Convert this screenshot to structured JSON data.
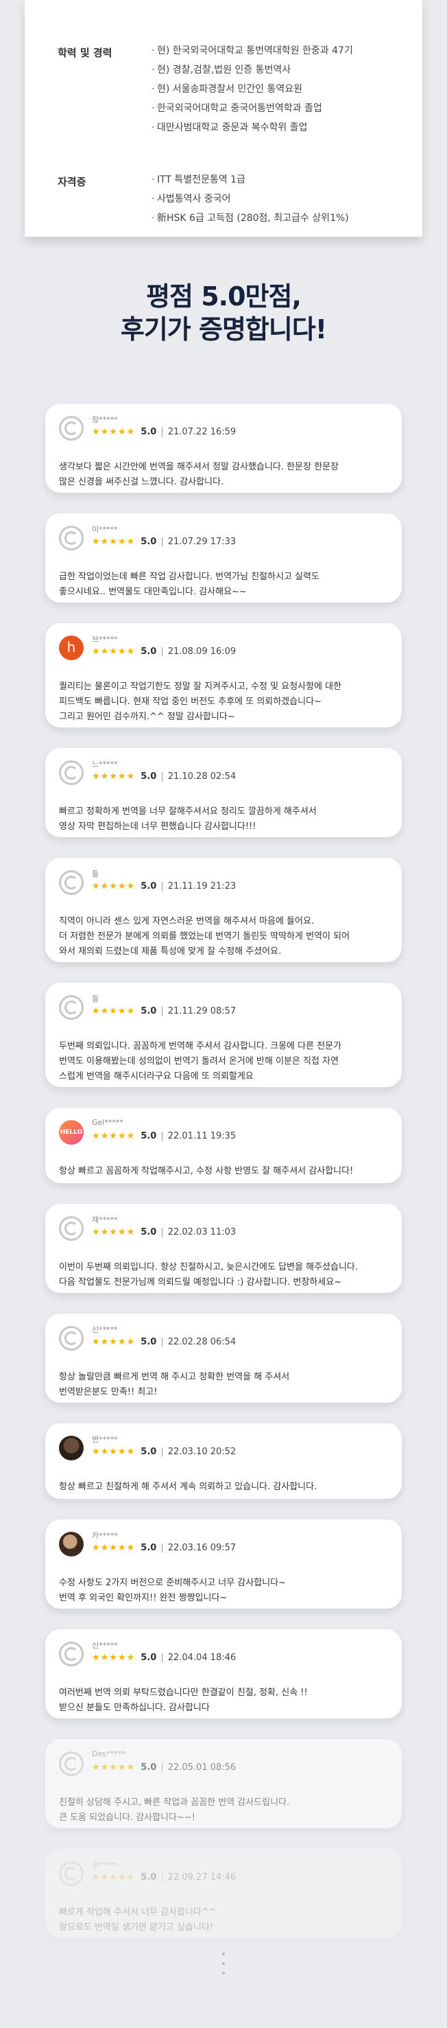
{
  "profile": {
    "education_label": "학력 및 경력",
    "education_items": [
      "현) 한국외국어대학교 통번역대학원 한중과 47기",
      "현) 경찰,검찰,법원 인증 통번역사",
      "현) 서울송파경찰서 민간인 통역요원",
      "한국외국어대학교 중국어통번역학과 졸업",
      "대만사범대학교 중문과 복수학위 졸업"
    ],
    "cert_label": "자격증",
    "cert_items": [
      "ITT 특별전문통역 1급",
      "사법통역사 중국어",
      "新HSK 6급 고득점 (280점, 최고급수 상위1%)"
    ]
  },
  "headline": {
    "line1": "평점 5.0만점,",
    "line2": "후기가 증명합니다!"
  },
  "reviews": [
    {
      "user": "장*****",
      "score": "5.0",
      "date": "21.07.22 16:59",
      "avatar": "default",
      "lines": [
        "생각보다 짧은 시간안에 번역을 해주셔서 정말 감사했습니다. 한문장 한문장",
        "많은 신경을 써주신걸 느꼈니다. 감사합니다."
      ]
    },
    {
      "user": "이*****",
      "score": "5.0",
      "date": "21.07.29 17:33",
      "avatar": "default",
      "lines": [
        "급한 작업이었는데 빠른 작업 감사합니다. 번역가님 친절하시고 실력도",
        "좋으시네요.. 번역물도 대만족입니다. 감사해요~~"
      ]
    },
    {
      "user": "브*****",
      "score": "5.0",
      "date": "21.08.09 16:09",
      "avatar": "h",
      "lines": [
        "퀄리티는 물론이고 작업기한도 정말 잘 지켜주시고, 수정 및 요청사항에 대한",
        "피드백도 빠릅니다. 현재 작업 중인 버전도 추후에 또 의뢰하겠습니다~",
        "그리고 원어민 검수까지.^^ 정말 감사합니다~"
      ]
    },
    {
      "user": "느*****",
      "score": "5.0",
      "date": "21.10.28 02:54",
      "avatar": "default",
      "lines": [
        "빠르고 정확하게 번역을 너무 잘해주셔서요 정리도 깔끔하게 해주셔서",
        "영상 자막 편집하는데 너무 편했습니다 감사합니다!!!"
      ]
    },
    {
      "user": "들",
      "score": "5.0",
      "date": "21.11.19 21:23",
      "avatar": "default",
      "lines": [
        "직역이 아니라 센스 있게 자연스러운 번역을 해주셔서 마음에 들어요.",
        "더 저렴한 전문가 분에게 의뢰를 했었는데 번역기 돌린듯 딱딱하게 번역이 되어",
        "와서 재의뢰 드렸는데 제품 특성에 맞게 잘 수정해 주셨어요."
      ]
    },
    {
      "user": "들",
      "score": "5.0",
      "date": "21.11.29 08:57",
      "avatar": "default",
      "lines": [
        "두번째 의뢰입니다. 꼼꼼하게 번역해 주셔서 감사합니다. 크몽에 다른 전문가",
        "번역도 이용해봤는데 성의없이 번역기 돌려서 온거에 반해 이분은 직접 자연",
        "스럽게 번역을 해주시더라구요 다음에 또 의뢰할게요"
      ]
    },
    {
      "user": "Gel*****",
      "score": "5.0",
      "date": "22.01.11 19:35",
      "avatar": "pink",
      "avatar_text": "HELLO",
      "lines": [
        "항상 빠르고 꼼꼼하게 작업해주시고, 수정 사항 반영도 잘 해주셔서 감사합니다!"
      ]
    },
    {
      "user": "재*****",
      "score": "5.0",
      "date": "22.02.03 11:03",
      "avatar": "default",
      "lines": [
        "이번이 두번째 의뢰입니다. 항상 친절하시고, 늦은시간에도 답변을 해주셨습니다.",
        "다음 작업물도 전문가님께 의뢰드릴 예정입니다 :) 감사합니다. 번창하세요~"
      ]
    },
    {
      "user": "신*****",
      "score": "5.0",
      "date": "22.02.28 06:54",
      "avatar": "default",
      "lines": [
        "항상 놀랄만큼 빠르게 번역 해 주시고 정확한 번역을 해 주셔서",
        "번역받은분도 만족!! 최고!"
      ]
    },
    {
      "user": "변*****",
      "score": "5.0",
      "date": "22.03.10 20:52",
      "avatar": "photo1",
      "lines": [
        "항상 빠르고 친절하게 해 주셔서 계속 의뢰하고 있습니다. 감사합니다."
      ]
    },
    {
      "user": "카*****",
      "score": "5.0",
      "date": "22.03.16 09:57",
      "avatar": "photo2",
      "lines": [
        "수정 사항도 2가지 버전으로 준비해주시고 너무 감사합니다~",
        "번역 후 외국인 확인까지!! 완전 짱짱입니다~"
      ]
    },
    {
      "user": "신*****",
      "score": "5.0",
      "date": "22.04.04 18:46",
      "avatar": "default",
      "lines": [
        "여러번째 번역 의뢰 부탁드렸습니다만 한결같이 친절, 정확, 신속 !!",
        "받으신 분들도 만족하십니다. 감사합니다"
      ]
    },
    {
      "user": "Des*****",
      "score": "5.0",
      "date": "22.05.01 08:56",
      "avatar": "default",
      "lines": [
        "친절히 상담해 주시고, 빠른 작업과 꼼꼼한 번역 감사드립니다.",
        "큰 도움 되었습니다. 감사합니다~~!"
      ]
    },
    {
      "user": "귀*****",
      "score": "5.0",
      "date": "22.09.27 14:46",
      "avatar": "default",
      "lines": [
        "빠르게 작업해 주셔서 너무 감사합니다^^",
        "앞으로도 번역일 생기면 맡기고 싶습니다!"
      ]
    }
  ],
  "icons": {
    "star": "star-icon",
    "default_avatar": "user-avatar-icon",
    "more": "more-dots-icon"
  },
  "colors": {
    "headline": "#17223c",
    "star": "#f4b400",
    "background": "#e9ebee"
  }
}
